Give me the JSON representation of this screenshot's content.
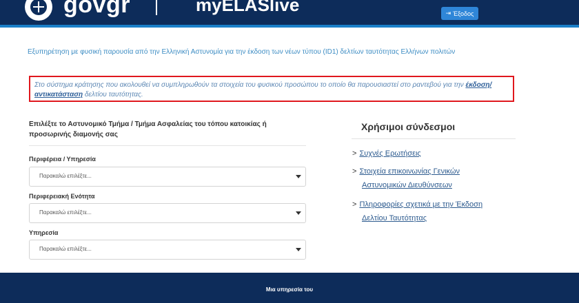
{
  "header": {
    "brand": "govgr",
    "app_title": "myELASlive",
    "logout_label": "Έξοδος",
    "logout_icon": "exit-icon"
  },
  "main": {
    "subtitle": "Εξυπηρέτηση με φυσική παρουσία από την Ελληνική Αστυνομία για την έκδοση των νέων τύπου (ID1) δελτίων ταυτότητας Ελλήνων πολιτών",
    "notice_part1": "Στο σύστημα κράτησης που ακολουθεί να συμπληρωθούν τα στοιχεία του φυσικού προσώπου το οποίο θα παρουσιαστεί στο ραντεβού για την ",
    "notice_bold": "έκδοση/αντικατάσταση",
    "notice_part2": " δελτίου ταυτότητας.",
    "select_heading": "Επιλέξτε το Αστυνομικό Τμήμα / Τμήμα Ασφαλείας του τόπου κατοικίας ή προσωρινής διαμονής σας",
    "fields": [
      {
        "label": "Περιφέρεια / Υπηρεσία",
        "value": "Παρακαλώ επιλέξτε..."
      },
      {
        "label": "Περιφερειακή Ενότητα",
        "value": "Παρακαλώ επιλέξτε..."
      },
      {
        "label": "Υπηρεσία",
        "value": "Παρακαλώ επιλέξτε..."
      }
    ]
  },
  "links": {
    "title": "Χρήσιμοι σύνδεσμοι",
    "items": [
      {
        "line1": "Συχνές Ερωτήσεις",
        "line2": ""
      },
      {
        "line1": "Στοιχεία επικοινωνίας Γενικών",
        "line2": "Αστυνομικών Διευθύνσεων"
      },
      {
        "line1": "Πληροφορίες σχετικά με την Έκδοση",
        "line2": "Δελτίου Ταυτότητας"
      }
    ],
    "marker": ">"
  },
  "footer": {
    "text": "Μια υπηρεσία του"
  },
  "colors": {
    "header_bg": "#0d2c5a",
    "accent": "#1a7fc8",
    "notice_border": "#e0171d",
    "link": "#2c5a8e"
  }
}
